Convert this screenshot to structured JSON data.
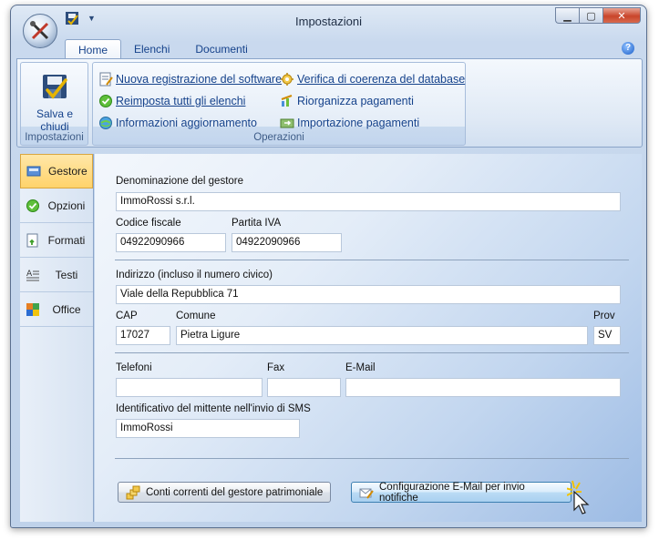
{
  "window": {
    "title": "Impostazioni",
    "minimize_icon": "minimize-icon",
    "maximize_icon": "maximize-icon",
    "close_icon": "close-icon"
  },
  "ribbon_tabs": [
    {
      "label": "Home",
      "active": true
    },
    {
      "label": "Elenchi",
      "active": false
    },
    {
      "label": "Documenti",
      "active": false
    }
  ],
  "ribbon": {
    "groups": {
      "impostazioni": {
        "label": "Impostazioni",
        "salva_line1": "Salva e",
        "salva_line2": "chiudi"
      },
      "operazioni": {
        "label": "Operazioni",
        "items": [
          {
            "label": "Nuova registrazione del software",
            "icon": "registration-icon"
          },
          {
            "label": "Reimposta tutti gli elenchi",
            "icon": "check-circle-icon"
          },
          {
            "label": "Informazioni aggiornamento",
            "icon": "globe-update-icon"
          },
          {
            "label": "Verifica di coerenza del database",
            "icon": "database-check-icon"
          },
          {
            "label": "Riorganizza pagamenti",
            "icon": "reorganize-icon"
          },
          {
            "label": "Importazione pagamenti",
            "icon": "import-icon"
          }
        ]
      }
    }
  },
  "sidebar": {
    "items": [
      {
        "label": "Gestore",
        "icon": "manager-icon",
        "active": true
      },
      {
        "label": "Opzioni",
        "icon": "options-check-icon",
        "active": false
      },
      {
        "label": "Formati",
        "icon": "formats-icon",
        "active": false
      },
      {
        "label": "Testi",
        "icon": "text-icon",
        "active": false
      },
      {
        "label": "Office",
        "icon": "office-icon",
        "active": false
      }
    ]
  },
  "form": {
    "denominazione": {
      "label": "Denominazione del gestore",
      "value": "ImmoRossi s.r.l."
    },
    "codice_fiscale": {
      "label": "Codice fiscale",
      "value": "04922090966"
    },
    "partita_iva": {
      "label": "Partita IVA",
      "value": "04922090966"
    },
    "indirizzo": {
      "label": "Indirizzo (incluso il numero civico)",
      "value": "Viale della Repubblica 71"
    },
    "cap": {
      "label": "CAP",
      "value": "17027"
    },
    "comune": {
      "label": "Comune",
      "value": "Pietra Ligure"
    },
    "prov": {
      "label": "Prov",
      "value": "SV"
    },
    "telefoni": {
      "label": "Telefoni",
      "value": ""
    },
    "fax": {
      "label": "Fax",
      "value": ""
    },
    "email": {
      "label": "E-Mail",
      "value": ""
    },
    "sms_id": {
      "label": "Identificativo del mittente nell'invio di SMS",
      "value": "ImmoRossi"
    }
  },
  "buttons": {
    "conti_correnti": "Conti correnti del gestore patrimoniale",
    "config_email": "Configurazione E-Mail per invio notifiche"
  },
  "colors": {
    "accent": "#15428b",
    "active_tab": "#ffd36b"
  }
}
